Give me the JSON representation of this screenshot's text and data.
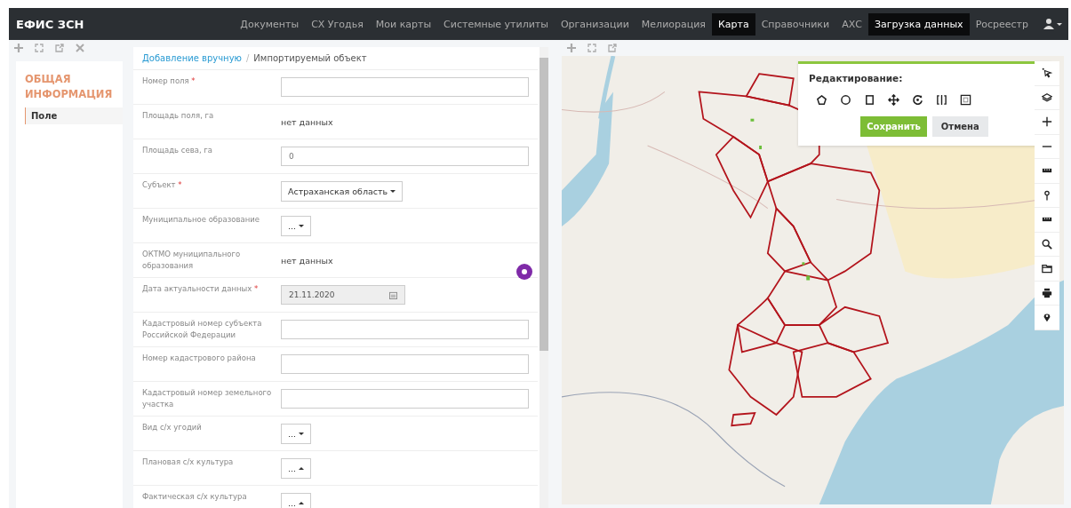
{
  "app_title": "ЕФИС ЗСН",
  "nav": [
    {
      "label": "Документы",
      "selected": false
    },
    {
      "label": "СХ Угодья",
      "selected": false
    },
    {
      "label": "Мои карты",
      "selected": false
    },
    {
      "label": "Системные утилиты",
      "selected": false
    },
    {
      "label": "Организации",
      "selected": false
    },
    {
      "label": "Мелиорация",
      "selected": false
    },
    {
      "label": "Карта",
      "selected": true
    },
    {
      "label": "Справочники",
      "selected": false
    },
    {
      "label": "АХС",
      "selected": false
    },
    {
      "label": "Загрузка данных",
      "selected": true
    },
    {
      "label": "Росреестр",
      "selected": false
    }
  ],
  "sidebar": {
    "section_title": "ОБЩАЯ ИНФОРМАЦИЯ",
    "items": [
      {
        "label": "Поле",
        "selected": true
      }
    ]
  },
  "breadcrumb": {
    "link": "Добавление вручную",
    "separator": "/",
    "current": "Импортируемый объект"
  },
  "fields": [
    {
      "label": "Номер поля",
      "required": true,
      "kind": "input"
    },
    {
      "label": "Площадь поля, га",
      "required": false,
      "kind": "text",
      "value": "нет данных"
    },
    {
      "label": "Площадь сева, га",
      "required": false,
      "kind": "input",
      "value": "0"
    },
    {
      "label": "Субъект",
      "required": true,
      "kind": "select",
      "value": "Астраханская область",
      "expanded": false
    },
    {
      "label": "Муниципальное образование",
      "required": false,
      "kind": "select",
      "value": "...",
      "expanded": false
    },
    {
      "label": "ОКТМО муниципального образования",
      "required": false,
      "kind": "text",
      "value": "нет данных"
    },
    {
      "label": "Дата актуальности данных",
      "required": true,
      "kind": "date",
      "value": "21.11.2020"
    },
    {
      "label": "Кадастровый номер субъекта Российской Федерации",
      "required": false,
      "kind": "input"
    },
    {
      "label": "Номер кадастрового района",
      "required": false,
      "kind": "input"
    },
    {
      "label": "Кадастровый номер земельного участка",
      "required": false,
      "kind": "input"
    },
    {
      "label": "Вид с/х угодий",
      "required": false,
      "kind": "select",
      "value": "...",
      "expanded": false
    },
    {
      "label": "Плановая с/х культура",
      "required": false,
      "kind": "select",
      "value": "...",
      "expanded": true
    },
    {
      "label": "Фактическая с/х культура",
      "required": false,
      "kind": "select",
      "value": "...",
      "expanded": true
    }
  ],
  "required_mark": "*",
  "editing": {
    "title": "Редактирование:",
    "save": "Сохранить",
    "cancel": "Отмена"
  }
}
